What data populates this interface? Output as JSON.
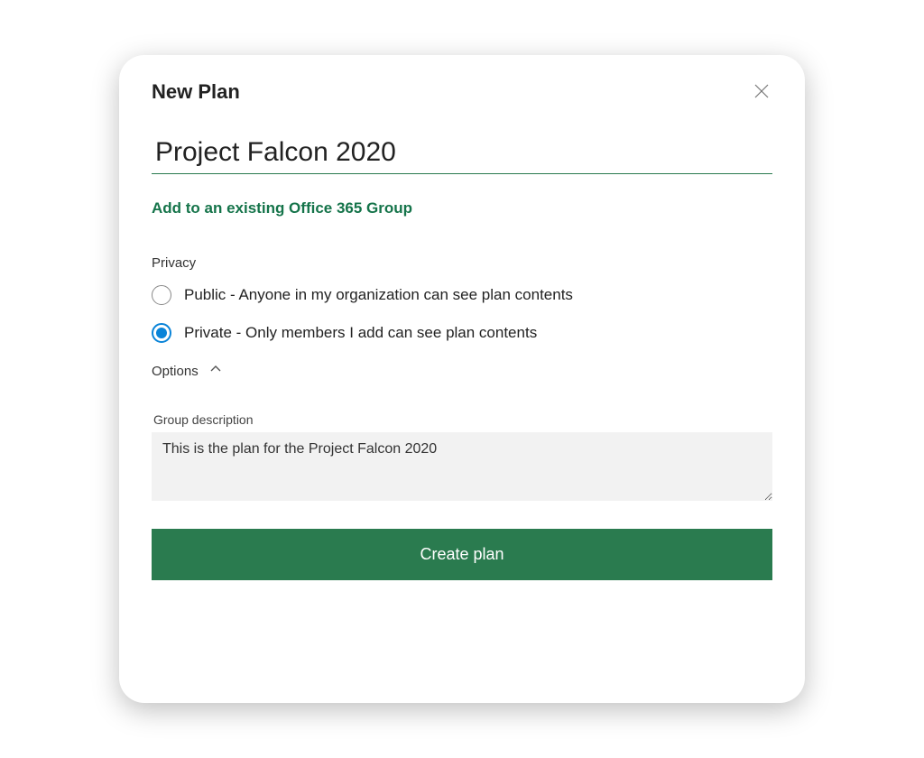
{
  "dialog": {
    "title": "New Plan",
    "plan_name_value": "Project Falcon 2020",
    "add_group_link": "Add to an existing Office 365 Group",
    "privacy": {
      "label": "Privacy",
      "options": [
        {
          "label": "Public - Anyone in my organization can see plan contents",
          "selected": false
        },
        {
          "label": "Private - Only members  I add can see plan contents",
          "selected": true
        }
      ]
    },
    "options_toggle": "Options",
    "description": {
      "label": "Group description",
      "value": "This is the plan for the Project Falcon 2020"
    },
    "create_button": "Create plan"
  },
  "icons": {
    "close": "close-icon",
    "chevron_up": "chevron-up-icon"
  },
  "colors": {
    "accent_green": "#2a7b4f",
    "link_green": "#15744a",
    "radio_blue": "#0a84d8"
  }
}
